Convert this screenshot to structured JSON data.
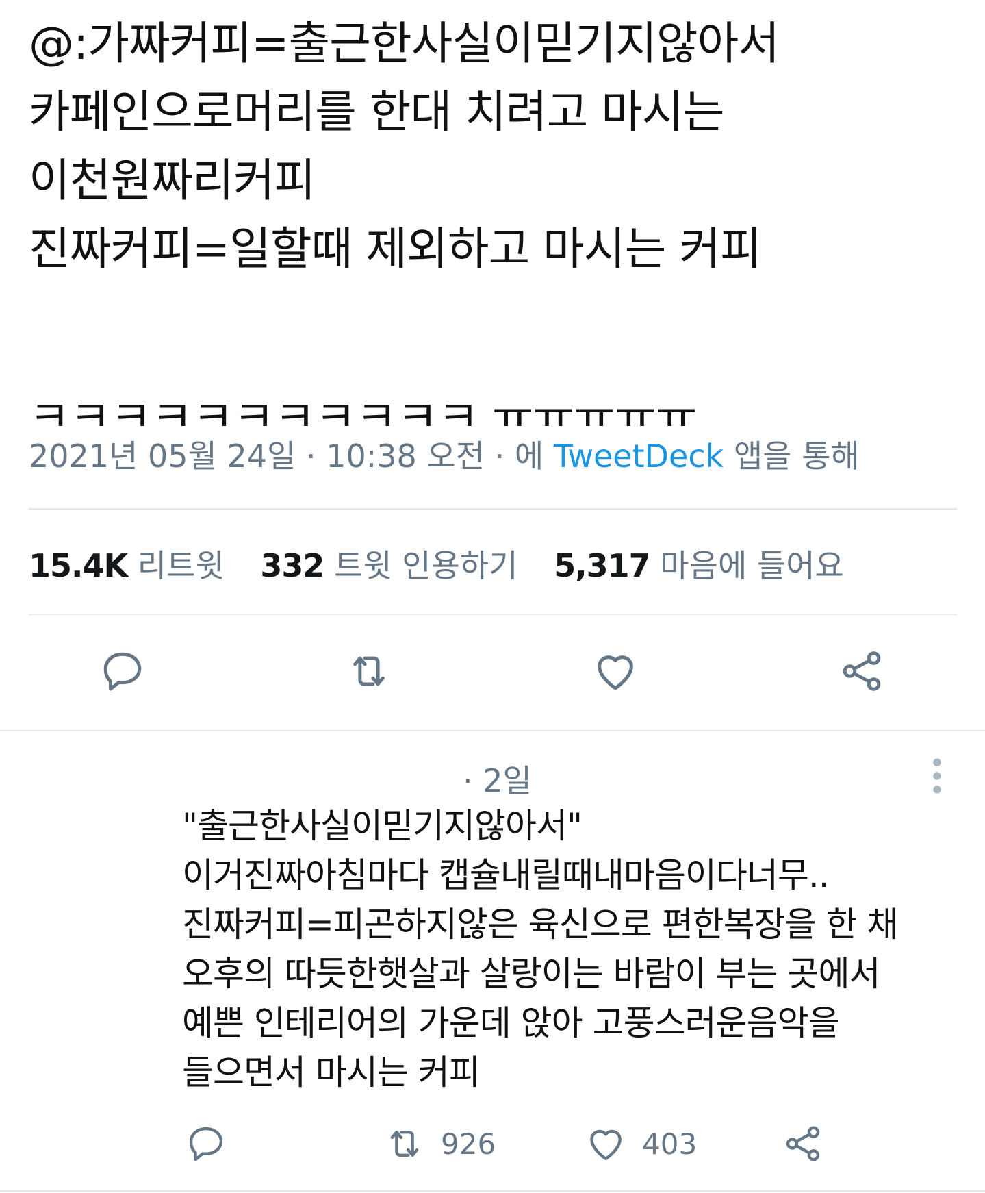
{
  "tweet": {
    "lines": [
      "@:가짜커피=출근한사실이믿기지않아서",
      "카페인으로머리를 한대 치려고 마시는",
      "이천원짜리커피",
      "진짜커피=일할때 제외하고 마시는 커피"
    ],
    "laugh_line": "ㅋㅋㅋㅋㅋㅋㅋㅋㅋㅋㅋ ㅠㅠㅠㅠㅠ",
    "meta": {
      "date": "2021년 05월 24일",
      "sep1": " · ",
      "time": "10:38 오전",
      "sep2": " · ",
      "via_prefix": "에 ",
      "source": "TweetDeck",
      "via_suffix": " 앱을 통해"
    }
  },
  "stats": {
    "retweets": {
      "count": "15.4K",
      "label": "리트윗"
    },
    "quotes": {
      "count": "332",
      "label": "트윗 인용하기"
    },
    "likes": {
      "count": "5,317",
      "label": "마음에 들어요"
    }
  },
  "actions": {
    "reply_icon": "reply-icon",
    "retweet_icon": "retweet-icon",
    "like_icon": "heart-icon",
    "share_icon": "share-icon"
  },
  "reply": {
    "time": "· 2일",
    "lines": [
      "\"출근한사실이믿기지않아서\"",
      "이거진짜아침마다 캡슐내릴때내마음이다너무..",
      "진짜커피=피곤하지않은 육신으로 편한복장을 한 채",
      "오후의 따듯한햇살과 살랑이는 바람이 부는 곳에서",
      "예쁜 인테리어의 가운데 앉아 고풍스러운음악을",
      "들으면서 마시는 커피"
    ],
    "retweet_count": "926",
    "like_count": "403"
  },
  "colors": {
    "text": "#14171a",
    "secondary": "#657786",
    "link": "#1b95e0",
    "divider": "#e1e8ed"
  }
}
